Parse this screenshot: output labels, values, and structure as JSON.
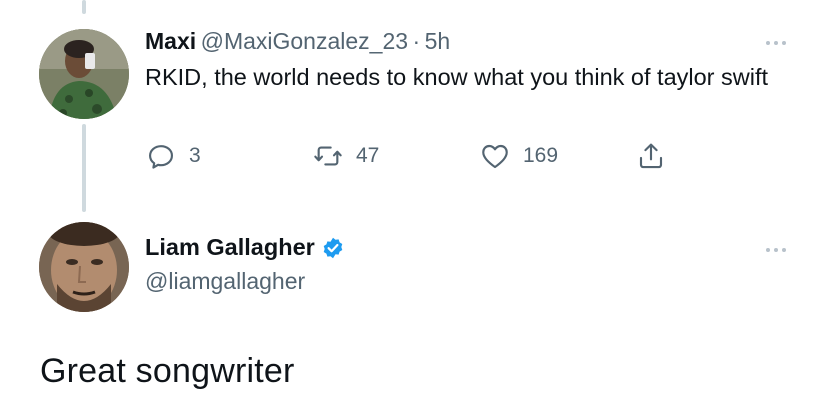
{
  "reply_tweet": {
    "author_name": "Maxi",
    "author_handle": "@MaxiGonzalez_23",
    "separator": "·",
    "time": "5h",
    "text": "RKID, the world needs to know what you think of taylor swift",
    "actions": {
      "reply_count": "3",
      "retweet_count": "47",
      "like_count": "169"
    }
  },
  "main_tweet": {
    "author_name": "Liam Gallagher",
    "author_handle": "@liamgallagher",
    "text": "Great songwriter"
  },
  "icons": {
    "reply": "reply-icon",
    "retweet": "retweet-icon",
    "like": "heart-icon",
    "share": "share-icon",
    "verified": "verified-badge-icon",
    "more": "more-options-icon"
  },
  "colors": {
    "text_primary": "#0f1419",
    "text_secondary": "#536471",
    "verified_blue": "#1d9bf0",
    "thread_line": "#cfd9de"
  }
}
